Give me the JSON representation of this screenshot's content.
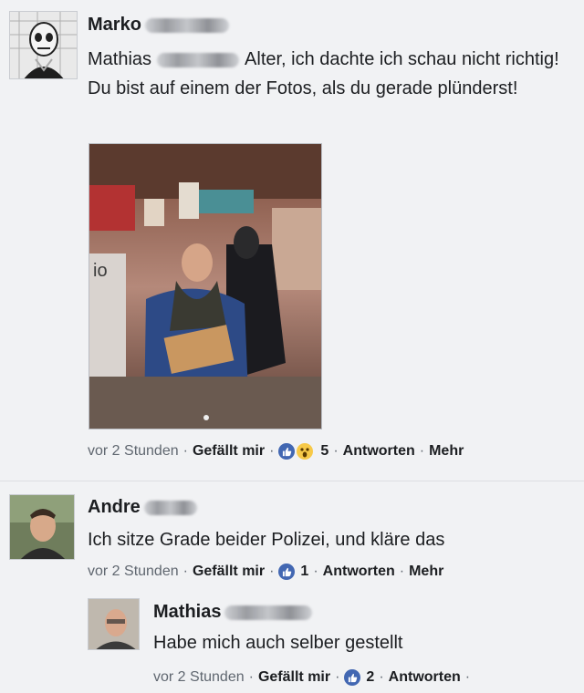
{
  "comments": [
    {
      "author": "Marko",
      "tagged": "Mathias",
      "text": "Alter, ich dachte ich schau nicht richtig! Du bist auf einem der Fotos, als du gerade plünderst!",
      "time": "vor 2 Stunden",
      "like_label": "Gefällt mir",
      "reactions_count": "5",
      "reply_label": "Antworten",
      "more_label": "Mehr",
      "photo_sign": "io"
    },
    {
      "author": "Andre",
      "text": "Ich sitze Grade beider Polizei, und kläre das",
      "time": "vor 2 Stunden",
      "like_label": "Gefällt mir",
      "reactions_count": "1",
      "reply_label": "Antworten",
      "more_label": "Mehr"
    },
    {
      "author": "Mathias",
      "text": "Habe mich auch selber gestellt",
      "time": "vor 2 Stunden",
      "like_label": "Gefällt mir",
      "reactions_count": "2",
      "reply_label": "Antworten"
    }
  ],
  "colors": {
    "like_blue": "#4267b2",
    "wow_yellow": "#f7c948",
    "background": "#f1f2f4"
  },
  "icons": [
    "like-icon",
    "wow-icon"
  ]
}
